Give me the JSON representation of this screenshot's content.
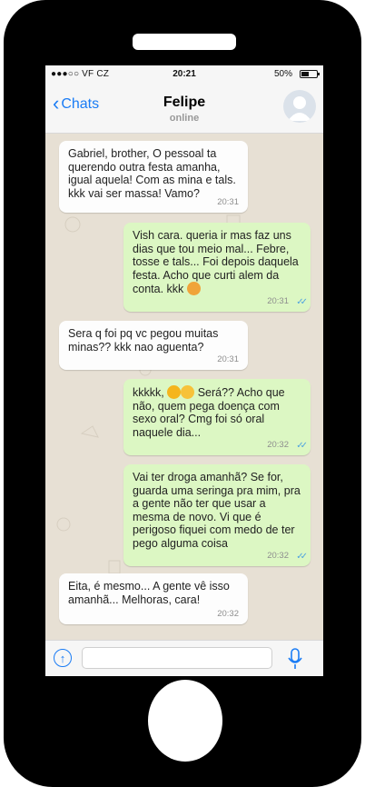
{
  "status_bar": {
    "carrier": "●●●○○ VF CZ",
    "time": "20:21",
    "battery": "50%"
  },
  "header": {
    "back_label": "Chats",
    "contact_name": "Felipe",
    "contact_status": "online"
  },
  "messages": [
    {
      "direction": "in",
      "text": "Gabriel, brother, O pessoal ta querendo outra festa amanha, igual aquela! Com as mina e tals. kkk vai ser massa! Vamo?",
      "time": "20:31"
    },
    {
      "direction": "out",
      "text": "Vish cara. queria ir mas faz uns dias que tou meio mal... Febre, tosse e tals... Foi depois daquela festa. Acho que curti alem da conta. kkk",
      "time": "20:31",
      "read": true
    },
    {
      "direction": "in",
      "text": "Sera q foi pq vc pegou muitas minas?? kkk nao aguenta?",
      "time": "20:31"
    },
    {
      "direction": "out",
      "text_before_emoji": "kkkkk,",
      "text": "Será?? Acho que não, quem pega doença com sexo oral? Cmg foi só oral naquele dia...",
      "time": "20:32",
      "read": true
    },
    {
      "direction": "out",
      "text": "Vai ter droga amanhã? Se for, guarda uma seringa pra mim, pra a gente não ter que usar a mesma de novo. Vi que é perigoso fiquei com medo de ter pego alguma coisa",
      "time": "20:32",
      "read": true
    },
    {
      "direction": "in",
      "text": "Eita, é mesmo... A gente vê isso amanhã... Melhoras, cara!",
      "time": "20:32"
    }
  ],
  "icons": {
    "back": "chevron-left-icon",
    "upload": "arrow-up-circle-icon",
    "mic": "microphone-icon",
    "emoji_sick": "sick-face-emoji",
    "emoji_dizzy": "dizzy-face-emoji",
    "emoji_grin": "grimace-emoji",
    "ticks": "double-check-icon"
  },
  "colors": {
    "accent": "#1a7cf5",
    "incoming_bubble": "#fdfdfd",
    "outgoing_bubble": "#dcf7c3",
    "read_ticks": "#4fa3e0",
    "chat_background": "#e7e0d4"
  }
}
